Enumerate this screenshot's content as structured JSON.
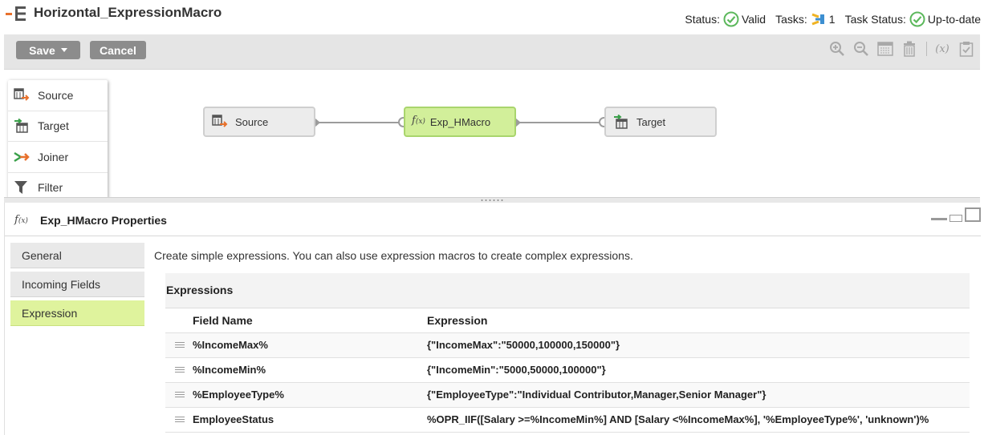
{
  "header": {
    "title": "Horizontal_ExpressionMacro",
    "status_label": "Status:",
    "status_value": "Valid",
    "tasks_label": "Tasks:",
    "tasks_value": "1",
    "task_status_label": "Task Status:",
    "task_status_value": "Up-to-date"
  },
  "toolbar": {
    "save_label": "Save",
    "cancel_label": "Cancel",
    "fx_label": "(x)",
    "icons": [
      "zoom-in-icon",
      "zoom-out-icon",
      "grid-icon",
      "delete-icon",
      "expression-icon",
      "validate-icon"
    ]
  },
  "palette": {
    "items": [
      {
        "label": "Source",
        "icon": "source-icon"
      },
      {
        "label": "Target",
        "icon": "target-icon"
      },
      {
        "label": "Joiner",
        "icon": "joiner-icon"
      },
      {
        "label": "Filter",
        "icon": "filter-icon"
      }
    ]
  },
  "canvas": {
    "nodes": [
      {
        "label": "Source",
        "icon": "source-icon"
      },
      {
        "label": "Exp_HMacro",
        "icon": "expression-icon"
      },
      {
        "label": "Target",
        "icon": "target-icon"
      }
    ]
  },
  "properties": {
    "title": "Exp_HMacro Properties",
    "tabs": [
      "General",
      "Incoming Fields",
      "Expression"
    ],
    "active_tab": "Expression",
    "description": "Create simple expressions. You can also use expression macros to create complex expressions.",
    "section_title": "Expressions",
    "columns": [
      "Field Name",
      "Expression"
    ],
    "rows": [
      {
        "field": "%IncomeMax%",
        "expression": "{\"IncomeMax\":\"50000,100000,150000\"}"
      },
      {
        "field": "%IncomeMin%",
        "expression": "{\"IncomeMin\":\"5000,50000,100000\"}"
      },
      {
        "field": "%EmployeeType%",
        "expression": "{\"EmployeeType\":\"Individual Contributor,Manager,Senior Manager\"}"
      },
      {
        "field": "EmployeeStatus",
        "expression": "%OPR_IIF([Salary >=%IncomeMin%] AND [Salary <%IncomeMax%], '%EmployeeType%', 'unknown')%"
      }
    ]
  },
  "colors": {
    "accent_green": "#dff39d",
    "node_selected": "#d2ef9a",
    "valid_green": "#5cb85c",
    "button_gray": "#8c8c8c"
  }
}
